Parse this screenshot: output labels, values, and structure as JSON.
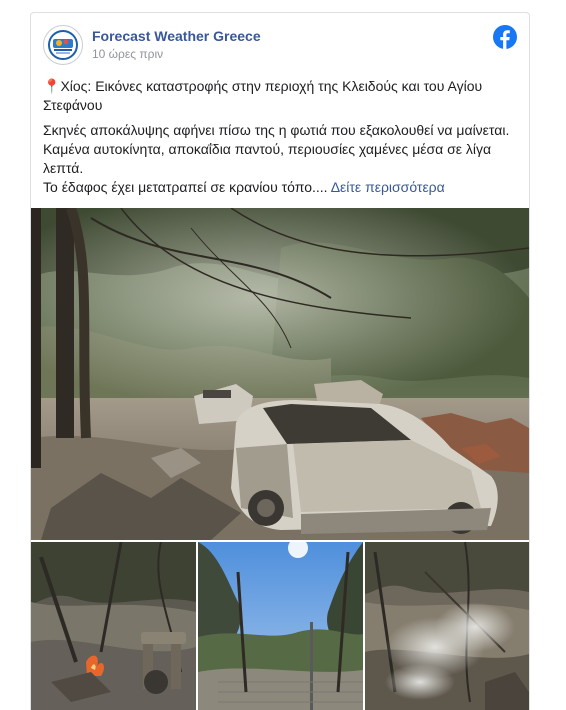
{
  "post": {
    "page_name": "Forecast Weather Greece",
    "timestamp": "10 ώρες πριν",
    "pin_emoji": "📍",
    "title_text": "Χίος: Εικόνες καταστροφής στην περιοχή της Κλειδούς και του Αγίου Στεφάνου",
    "body_text": "Σκηνές αποκάλυψης αφήνει πίσω της η φωτιά που εξακολουθεί να μαίνεται. Καμένα αυτοκίνητα, αποκαΐδια παντού, περιουσίες χαμένες μέσα σε λίγα λεπτά.",
    "body_text_2": "Το έδαφος έχει μετατραπεί σε κρανίου τόπο....",
    "see_more": "Δείτε περισσότερα"
  },
  "icons": {
    "avatar": "weather-logo-icon",
    "network": "facebook-icon"
  },
  "colors": {
    "link": "#385898",
    "facebook_blue": "#1877f2",
    "meta_text": "#90949c",
    "border": "#dddfe2"
  },
  "photos": [
    "burned-cars-forest-photo",
    "burned-ground-fire-photo",
    "burned-forest-sky-photo",
    "smoking-ground-photo"
  ]
}
